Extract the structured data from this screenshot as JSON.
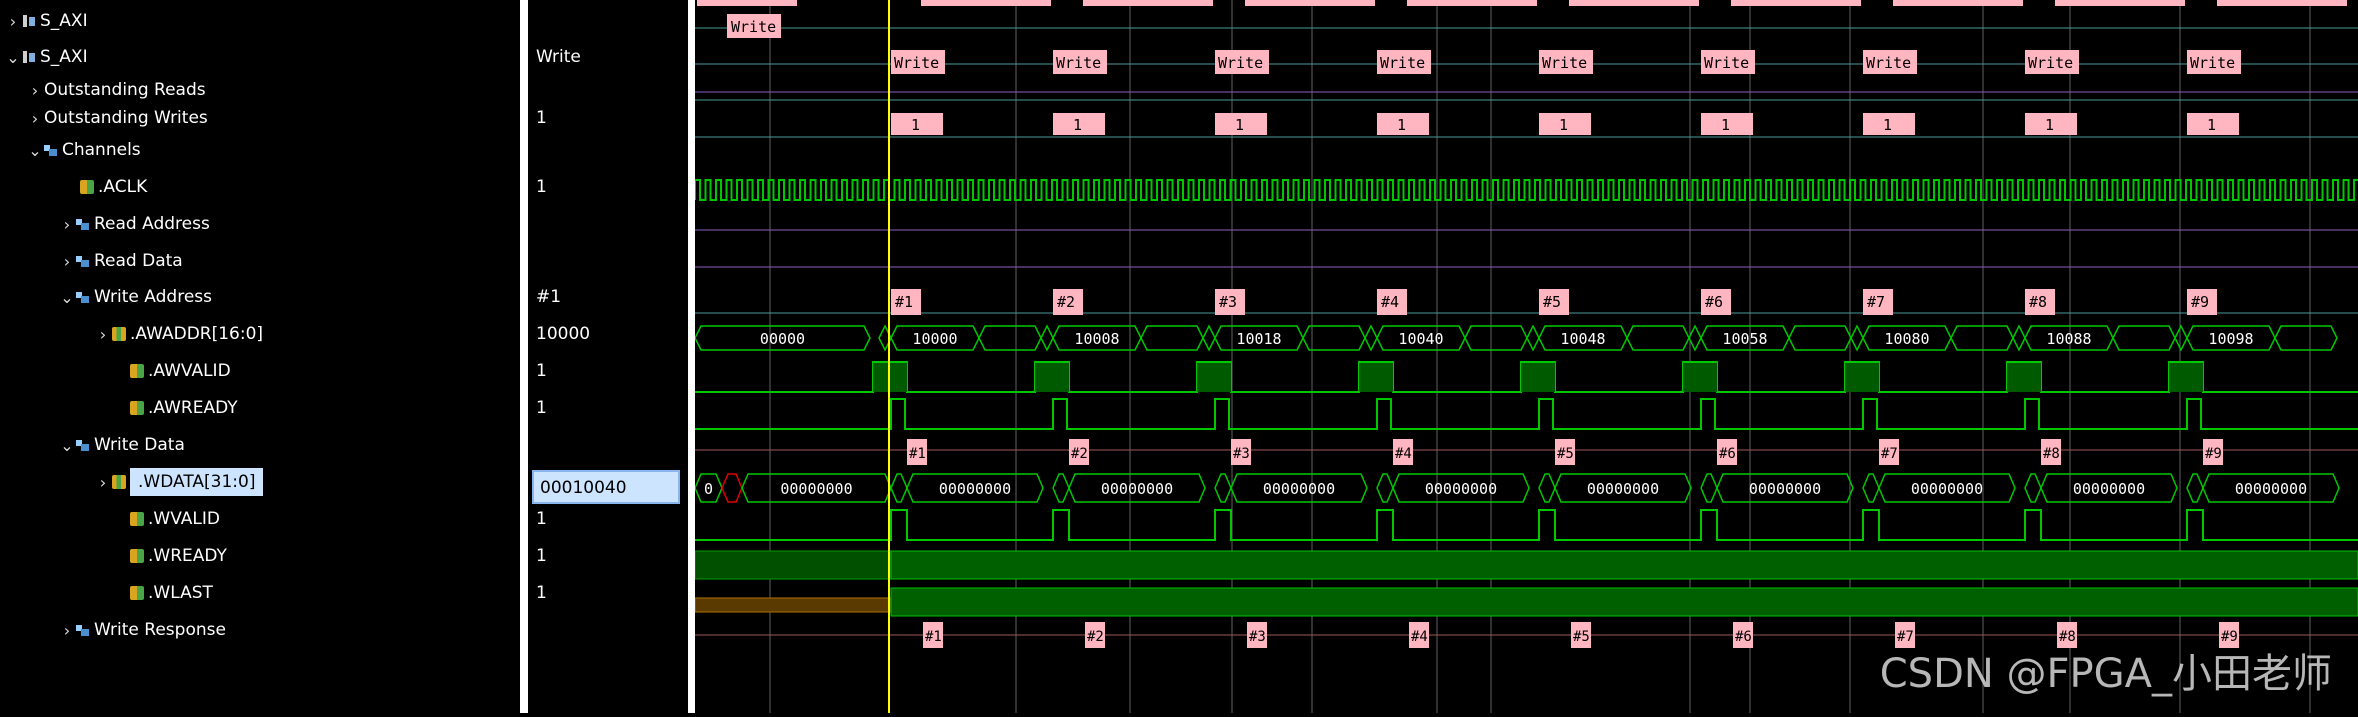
{
  "tree": [
    {
      "label": "S_AXI",
      "indent": 4,
      "chev": "›",
      "icon": "bus",
      "icon_name": "bus-interface-icon"
    },
    {
      "label": "S_AXI",
      "indent": 4,
      "chev": "⌄",
      "icon": "bus",
      "icon_name": "bus-interface-icon"
    },
    {
      "label": "Outstanding Reads",
      "indent": 26,
      "chev": "›",
      "icon": "",
      "icon_name": ""
    },
    {
      "label": "Outstanding Writes",
      "indent": 26,
      "chev": "›",
      "icon": "",
      "icon_name": ""
    },
    {
      "label": "Channels",
      "indent": 26,
      "chev": "⌄",
      "icon": "grp",
      "icon_name": "channel-group-icon"
    },
    {
      "label": ".ACLK",
      "indent": 62,
      "chev": "",
      "icon": "sig",
      "icon_name": "signal-icon"
    },
    {
      "label": "Read Address",
      "indent": 58,
      "chev": "›",
      "icon": "grp",
      "icon_name": "channel-group-icon"
    },
    {
      "label": "Read Data",
      "indent": 58,
      "chev": "›",
      "icon": "grp",
      "icon_name": "channel-group-icon"
    },
    {
      "label": "Write Address",
      "indent": 58,
      "chev": "⌄",
      "icon": "grp",
      "icon_name": "channel-group-icon"
    },
    {
      "label": ".AWADDR[16:0]",
      "indent": 94,
      "chev": "›",
      "icon": "vec",
      "icon_name": "bus-signal-icon"
    },
    {
      "label": ".AWVALID",
      "indent": 112,
      "chev": "",
      "icon": "sig",
      "icon_name": "signal-icon"
    },
    {
      "label": ".AWREADY",
      "indent": 112,
      "chev": "",
      "icon": "sig",
      "icon_name": "signal-icon"
    },
    {
      "label": "Write Data",
      "indent": 58,
      "chev": "⌄",
      "icon": "grp",
      "icon_name": "channel-group-icon"
    },
    {
      "label": ".WDATA[31:0]",
      "indent": 94,
      "chev": "›",
      "icon": "vec",
      "icon_name": "bus-signal-icon",
      "selected": true
    },
    {
      "label": ".WVALID",
      "indent": 112,
      "chev": "",
      "icon": "sig",
      "icon_name": "signal-icon"
    },
    {
      "label": ".WREADY",
      "indent": 112,
      "chev": "",
      "icon": "sig",
      "icon_name": "signal-icon"
    },
    {
      "label": ".WLAST",
      "indent": 112,
      "chev": "",
      "icon": "sig",
      "icon_name": "signal-icon"
    },
    {
      "label": "Write Response",
      "indent": 58,
      "chev": "›",
      "icon": "grp",
      "icon_name": "channel-group-icon"
    }
  ],
  "values": [
    "",
    "Write",
    "",
    "1",
    "",
    "1",
    "",
    "",
    "#1",
    "10000",
    "1",
    "1",
    "",
    "00010040",
    "1",
    "1",
    "1",
    ""
  ],
  "waves": {
    "txn0_label": "Write",
    "write_label": "Write",
    "outstanding_label": "1",
    "aw_labels": [
      "#1",
      "#2",
      "#3",
      "#4",
      "#5",
      "#6",
      "#7",
      "#8",
      "#9"
    ],
    "addr_first": "00000",
    "addrs": [
      "10000",
      "10008",
      "10018",
      "10040",
      "10048",
      "10058",
      "10080",
      "10088",
      "10098"
    ],
    "wdata_first": "0",
    "wdata_value": "00000000",
    "w_labels": [
      "#1",
      "#2",
      "#3",
      "#4",
      "#5",
      "#6",
      "#7",
      "#8",
      "#9"
    ],
    "b_labels": [
      "#1",
      "#2",
      "#3",
      "#4",
      "#5",
      "#6",
      "#7",
      "#8",
      "#9"
    ]
  },
  "watermark": "CSDN @FPGA_小田老师",
  "colors": {
    "green": "#00c800",
    "pink": "#ffb6c1",
    "cursor": "#ffff00",
    "grid": "#606060",
    "teal": "#4c9a9a",
    "purple": "#8e5ec8"
  }
}
